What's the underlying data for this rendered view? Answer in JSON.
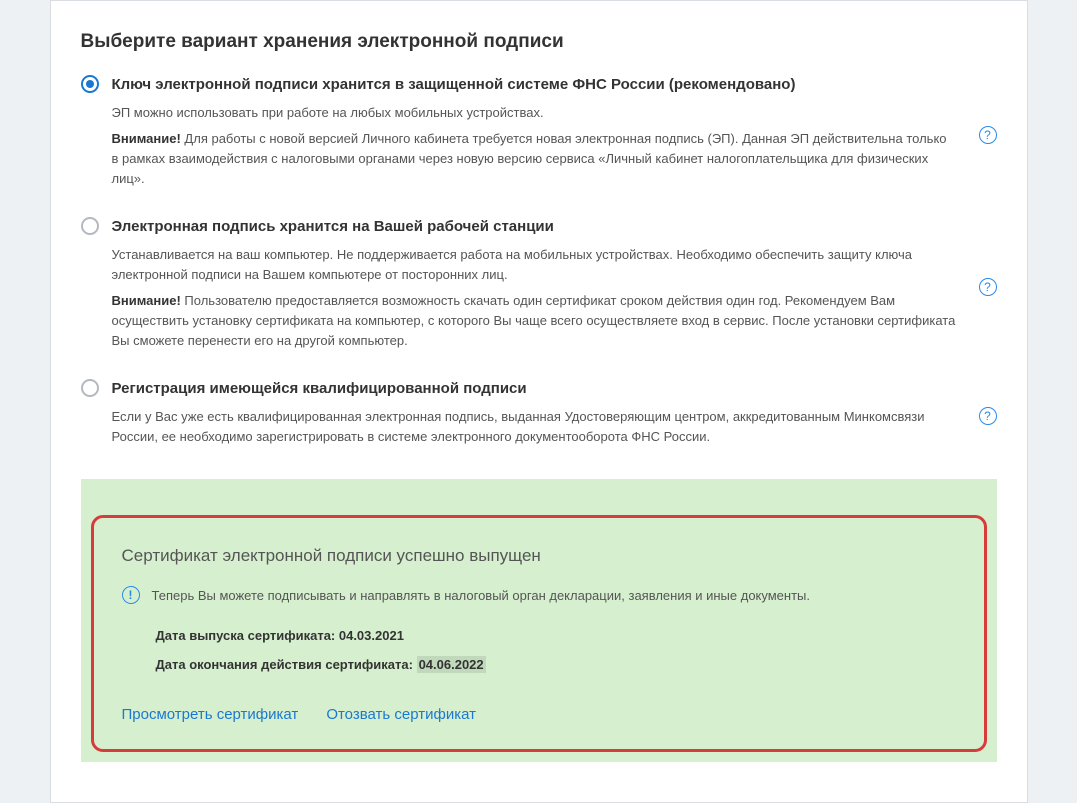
{
  "page_title": "Выберите вариант хранения электронной подписи",
  "options": [
    {
      "title": "Ключ электронной подписи хранится в защищенной системе ФНС России (рекомендовано)",
      "desc1": "ЭП можно использовать при работе на любых мобильных устройствах.",
      "warn_label": "Внимание!",
      "warn_text": " Для работы с новой версией Личного кабинета требуется новая электронная подпись (ЭП). Данная ЭП  действительна только в рамках взаимодействия с налоговыми органами через новую версию сервиса  «Личный кабинет налогоплательщика для физических лиц».",
      "selected": true
    },
    {
      "title": "Электронная подпись хранится на Вашей рабочей станции",
      "desc1": "Устанавливается на ваш компьютер. Не поддерживается работа на мобильных устройствах. Необходимо обеспечить  защиту ключа электронной подписи на Вашем компьютере от посторонних лиц.",
      "warn_label": "Внимание!",
      "warn_text": " Пользователю предоставляется возможность скачать один сертификат  сроком действия один год. Рекомендуем Вам осуществить установку сертификата на компьютер, с которого Вы  чаще всего осуществляете вход в сервис. После установки сертификата Вы сможете перенести его на другой  компьютер.",
      "selected": false
    },
    {
      "title": "Регистрация имеющейся квалифицированной подписи",
      "desc1": "Если у Вас уже есть квалифицированная электронная подпись, выданная Удостоверяющим центром, аккредитованным Минкомсвязи России, ее необходимо зарегистрировать в системе электронного документооборота ФНС России.",
      "warn_label": "",
      "warn_text": "",
      "selected": false
    }
  ],
  "success": {
    "title": "Сертификат электронной подписи успешно выпущен",
    "info_text": "Теперь Вы можете подписывать и направлять в налоговый орган декларации, заявления и иные документы.",
    "issue_label": "Дата выпуска сертификата: ",
    "issue_date": "04.03.2021",
    "expiry_label": "Дата окончания действия сертификата: ",
    "expiry_date": "04.06.2022",
    "view_link": "Просмотреть сертификат",
    "revoke_link": "Отозвать сертификат"
  }
}
